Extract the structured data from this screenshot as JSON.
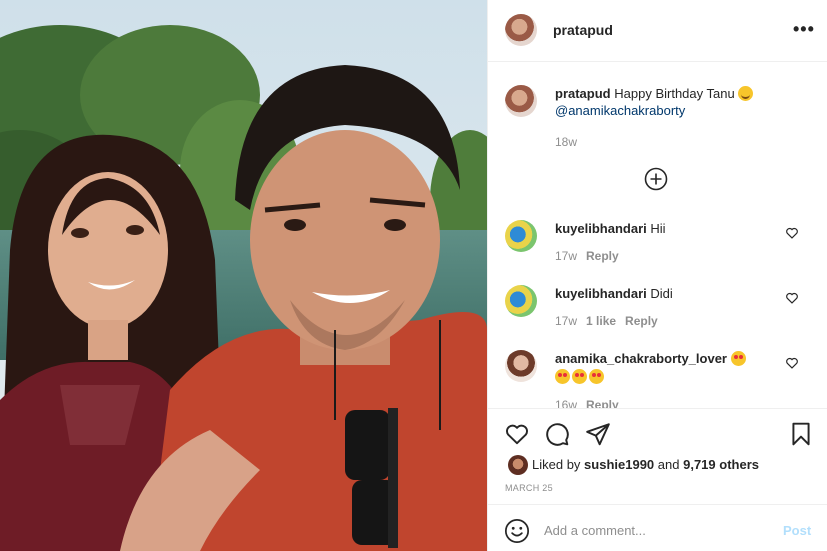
{
  "post": {
    "author": "pratapud",
    "more_label": "•••"
  },
  "caption": {
    "username": "pratapud",
    "text": "Happy Birthday Tanu",
    "emoji": "smiling-face-with-hearts-icon",
    "mention": "@anamikachakraborty",
    "time": "18w"
  },
  "comments": [
    {
      "username": "kuyelibhandari",
      "text": "Hii",
      "time": "17w",
      "likes": "",
      "reply": "Reply"
    },
    {
      "username": "kuyelibhandari",
      "text": "Didi",
      "time": "17w",
      "likes": "1 like",
      "reply": "Reply"
    },
    {
      "username": "anamika_chakraborty_lover",
      "text": "",
      "emoji": "star-struck-icon",
      "time": "16w",
      "likes": "",
      "reply": "Reply"
    }
  ],
  "actions": {
    "liked_by_prefix": "Liked by",
    "liked_by_user": "sushie1990",
    "liked_by_and": "and",
    "liked_by_count": "9,719 others",
    "date": "MARCH 25"
  },
  "add_comment": {
    "placeholder": "Add a comment...",
    "post_label": "Post"
  },
  "colors": {
    "link": "#00376b",
    "muted": "#8e8e8e",
    "post_disabled": "#b2dffc",
    "border": "#efefef"
  }
}
